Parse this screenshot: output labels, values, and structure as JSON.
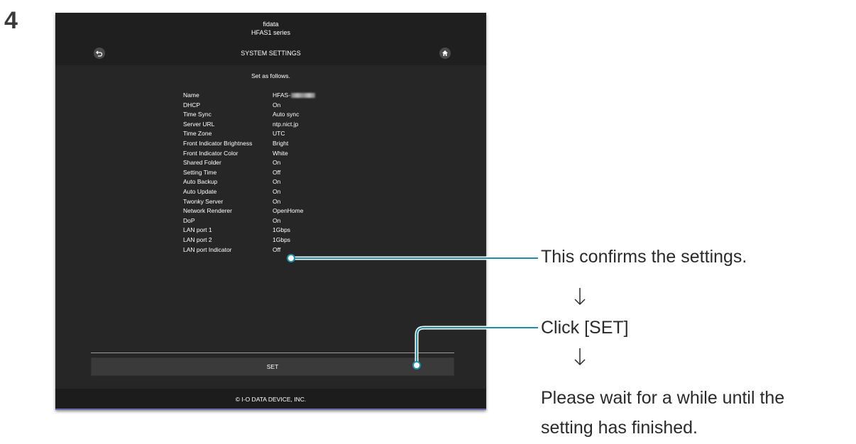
{
  "step_number": "4",
  "window": {
    "brand": "fidata",
    "model": "HFAS1 series",
    "title": "SYSTEM SETTINGS",
    "back_icon": "back-arrow-icon",
    "home_icon": "home-icon",
    "subtitle": "Set as follows.",
    "settings": [
      {
        "label": "Name",
        "value": "HFAS-"
      },
      {
        "label": "DHCP",
        "value": "On"
      },
      {
        "label": "Time Sync",
        "value": "Auto sync"
      },
      {
        "label": "Server URL",
        "value": "ntp.nict.jp"
      },
      {
        "label": "Time Zone",
        "value": "UTC"
      },
      {
        "label": "Front Indicator Brightness",
        "value": "Bright"
      },
      {
        "label": "Front Indicator Color",
        "value": "White"
      },
      {
        "label": "Shared Folder",
        "value": "On"
      },
      {
        "label": "Setting Time",
        "value": "Off"
      },
      {
        "label": "Auto Backup",
        "value": "On"
      },
      {
        "label": "Auto Update",
        "value": "On"
      },
      {
        "label": "Twonky Server",
        "value": "On"
      },
      {
        "label": "Network Renderer",
        "value": "OpenHome"
      },
      {
        "label": "DoP",
        "value": "On"
      },
      {
        "label": "LAN port 1",
        "value": "1Gbps"
      },
      {
        "label": "LAN port 2",
        "value": "1Gbps"
      },
      {
        "label": "LAN port Indicator",
        "value": "Off"
      }
    ],
    "set_label": "SET",
    "footer": "© I-O DATA DEVICE, INC."
  },
  "annotations": {
    "confirm": "This confirms the settings.",
    "click_set": "Click [SET]",
    "wait_line1": "Please wait for a while until the",
    "wait_line2": "setting has finished."
  },
  "colors": {
    "callout_line": "#1f8fa8",
    "window_bg": "#262626",
    "header_bg": "#1f1f1f"
  }
}
